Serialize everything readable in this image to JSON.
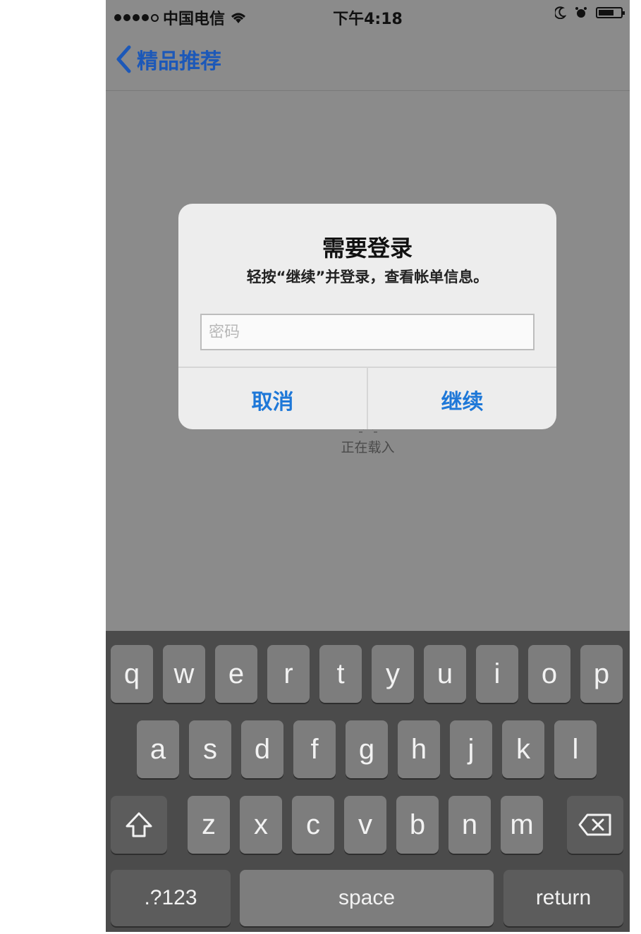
{
  "status_bar": {
    "carrier": "中国电信",
    "time": "下午4:18"
  },
  "nav": {
    "back_label": "精品推荐"
  },
  "loading": {
    "label": "正在载入"
  },
  "alert": {
    "title": "需要登录",
    "message": "轻按“继续”并登录，查看帐单信息。",
    "password_placeholder": "密码",
    "cancel_label": "取消",
    "continue_label": "继续"
  },
  "keyboard": {
    "row1": [
      "q",
      "w",
      "e",
      "r",
      "t",
      "y",
      "u",
      "i",
      "o",
      "p"
    ],
    "row2": [
      "a",
      "s",
      "d",
      "f",
      "g",
      "h",
      "j",
      "k",
      "l"
    ],
    "row3": [
      "z",
      "x",
      "c",
      "v",
      "b",
      "n",
      "m"
    ],
    "numbers_label": ".?123",
    "space_label": "space",
    "return_label": "return"
  },
  "colors": {
    "accent": "#1e78d8",
    "nav_tint": "#1c58b8",
    "dim_background": "#8b8b8b",
    "keyboard_background": "#4b4b4b"
  }
}
